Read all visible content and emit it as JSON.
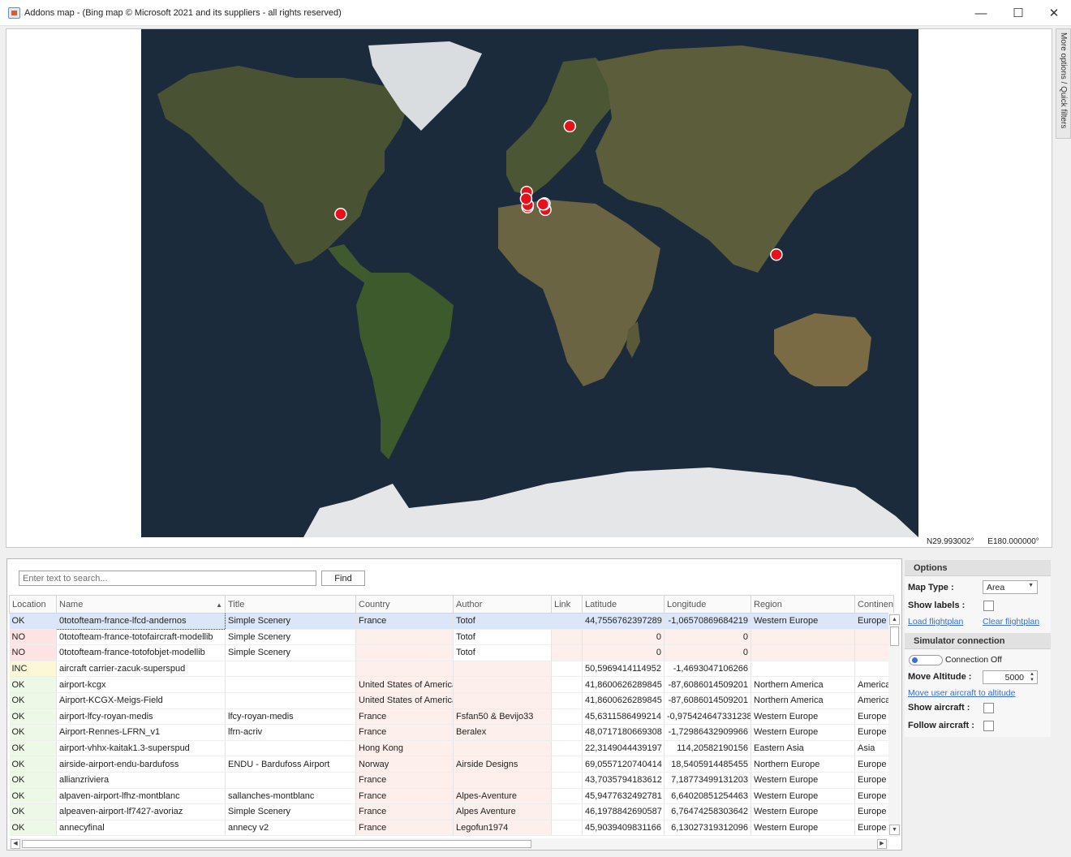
{
  "window": {
    "title": "Addons map - (Bing map © Microsoft 2021 and its suppliers - all rights reserved)",
    "minimize_glyph": "—",
    "maximize_glyph": "☐",
    "close_glyph": "✕"
  },
  "map": {
    "coordinate_readout": {
      "lat": "N29.993002°",
      "lon": "E180.000000°"
    },
    "marker_color": "#e8101a"
  },
  "side_tab": {
    "label": "More options / Quick filters"
  },
  "search": {
    "placeholder": "Enter text to search...",
    "find_label": "Find"
  },
  "table": {
    "columns": [
      "Location",
      "Name",
      "Title",
      "Country",
      "Author",
      "Link",
      "Latitude",
      "Longitude",
      "Region",
      "Continent"
    ],
    "rows": [
      {
        "status": "OK",
        "name": "0totofteam-france-lfcd-andernos",
        "title": "Simple Scenery",
        "country": "France",
        "author": "Totof",
        "link": "",
        "lat": "44,7556762397289",
        "lon": "-1,06570869684219",
        "region": "Western Europe",
        "continent": "Europe"
      },
      {
        "status": "NO",
        "name": "0totofteam-france-totofaircraft-modellib",
        "title": "Simple Scenery",
        "country": "",
        "author": "Totof",
        "link": "",
        "lat": "0",
        "lon": "0",
        "region": "",
        "continent": ""
      },
      {
        "status": "NO",
        "name": "0totofteam-france-totofobjet-modellib",
        "title": "Simple Scenery",
        "country": "",
        "author": "Totof",
        "link": "",
        "lat": "0",
        "lon": "0",
        "region": "",
        "continent": ""
      },
      {
        "status": "INC",
        "name": "aircraft carrier-zacuk-superspud",
        "title": "",
        "country": "",
        "author": "",
        "link": "",
        "lat": "50,5969414114952",
        "lon": "-1,4693047106266",
        "region": "",
        "continent": ""
      },
      {
        "status": "OK",
        "name": "airport-kcgx",
        "title": "",
        "country": "United States of America",
        "author": "",
        "link": "",
        "lat": "41,8600626289845",
        "lon": "-87,6086014509201",
        "region": "Northern America",
        "continent": "Americas"
      },
      {
        "status": "OK",
        "name": "Airport-KCGX-Meigs-Field",
        "title": "",
        "country": "United States of America",
        "author": "",
        "link": "",
        "lat": "41,8600626289845",
        "lon": "-87,6086014509201",
        "region": "Northern America",
        "continent": "Americas"
      },
      {
        "status": "OK",
        "name": "airport-lfcy-royan-medis",
        "title": "lfcy-royan-medis",
        "country": "France",
        "author": "Fsfan50 & Bevijo33",
        "link": "",
        "lat": "45,6311586499214",
        "lon": "-0,975424647331238",
        "region": "Western Europe",
        "continent": "Europe"
      },
      {
        "status": "OK",
        "name": "Airport-Rennes-LFRN_v1",
        "title": "lfrn-acriv",
        "country": "France",
        "author": "Beralex",
        "link": "",
        "lat": "48,0717180669308",
        "lon": "-1,72986432909966",
        "region": "Western Europe",
        "continent": "Europe"
      },
      {
        "status": "OK",
        "name": "airport-vhhx-kaitak1.3-superspud",
        "title": "",
        "country": "Hong Kong",
        "author": "",
        "link": "",
        "lat": "22,3149044439197",
        "lon": "114,20582190156",
        "region": "Eastern Asia",
        "continent": "Asia"
      },
      {
        "status": "OK",
        "name": "airside-airport-endu-bardufoss",
        "title": "ENDU - Bardufoss Airport",
        "country": "Norway",
        "author": "Airside Designs",
        "link": "",
        "lat": "69,0557120740414",
        "lon": "18,5405914485455",
        "region": "Northern Europe",
        "continent": "Europe"
      },
      {
        "status": "OK",
        "name": "allianzriviera",
        "title": "",
        "country": "France",
        "author": "",
        "link": "",
        "lat": "43,7035794183612",
        "lon": "7,18773499131203",
        "region": "Western Europe",
        "continent": "Europe"
      },
      {
        "status": "OK",
        "name": "alpaven-airport-lfhz-montblanc",
        "title": "sallanches-montblanc",
        "country": "France",
        "author": "Alpes-Aventure",
        "link": "",
        "lat": "45,9477632492781",
        "lon": "6,64020851254463",
        "region": "Western Europe",
        "continent": "Europe"
      },
      {
        "status": "OK",
        "name": "alpeaven-airport-lf7427-avoriaz",
        "title": "Simple Scenery",
        "country": "France",
        "author": "Alpes Aventure",
        "link": "",
        "lat": "46,1978842690587",
        "lon": "6,76474258303642",
        "region": "Western Europe",
        "continent": "Europe"
      },
      {
        "status": "OK",
        "name": "annecyfinal",
        "title": "annecy v2",
        "country": "France",
        "author": "Legofun1974",
        "link": "",
        "lat": "45,9039409831166",
        "lon": "6,13027319312096",
        "region": "Western Europe",
        "continent": "Europe"
      }
    ]
  },
  "options": {
    "header": "Options",
    "map_type_label": "Map Type :",
    "map_type_value": "Area",
    "show_labels_label": "Show labels :",
    "load_flightplan": "Load flightplan",
    "clear_flightplan": "Clear flightplan",
    "sim_header": "Simulator connection",
    "connection_text": "Connection Off",
    "move_altitude_label": "Move Altitude :",
    "move_altitude_value": "5000",
    "move_user_link": "Move user aircraft to altitude",
    "show_aircraft_label": "Show aircraft :",
    "follow_aircraft_label": "Follow aircraft :"
  }
}
